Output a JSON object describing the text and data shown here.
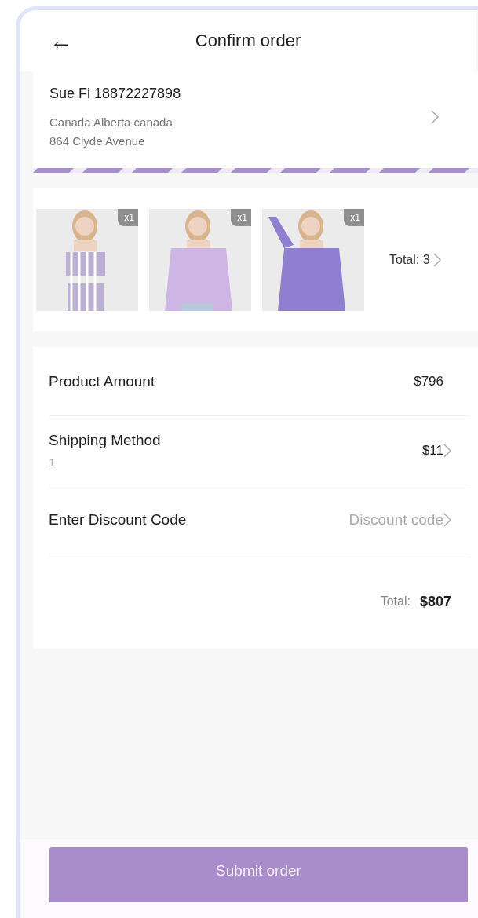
{
  "header": {
    "back": "←",
    "title": "Confirm order"
  },
  "address": {
    "name_phone": "Sue Fi 18872227898",
    "line_1": "Canada Alberta canada",
    "line_2": "864 Clyde Avenue"
  },
  "products": {
    "items": [
      {
        "kind": "picture",
        "quantity": "x1"
      },
      {
        "kind": "picture",
        "quantity": "x1"
      },
      {
        "kind": "picture",
        "quantity": "x1"
      }
    ],
    "total": "Total: 3"
  },
  "summary": {
    "rows": [
      {
        "label": "Product Amount",
        "value": "$796",
        "chevron": false
      },
      {
        "label": "Shipping Method",
        "sub": "1",
        "value": "$11",
        "chevron": true
      },
      {
        "label": "Enter Discount Code",
        "placeholder": "Discount code",
        "chevron": true
      }
    ],
    "total_label": "Total:",
    "total_value": "$807"
  },
  "submit": "Submit order"
}
